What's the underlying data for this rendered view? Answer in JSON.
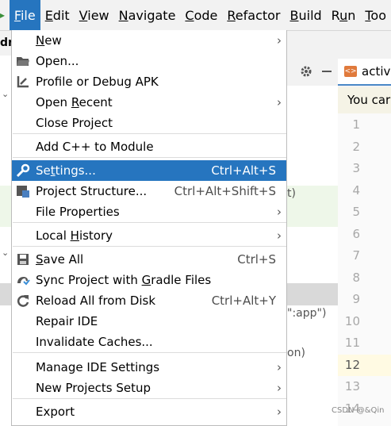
{
  "menubar": {
    "items": [
      {
        "label": "File",
        "mnemonic": "F"
      },
      {
        "label": "Edit",
        "mnemonic": "E"
      },
      {
        "label": "View",
        "mnemonic": "V"
      },
      {
        "label": "Navigate",
        "mnemonic": "N"
      },
      {
        "label": "Code",
        "mnemonic": "C"
      },
      {
        "label": "Refactor",
        "mnemonic": "R"
      },
      {
        "label": "Build",
        "mnemonic": "B"
      },
      {
        "label": "Run",
        "mnemonic": "u"
      },
      {
        "label": "Too",
        "mnemonic": "T"
      }
    ]
  },
  "background": {
    "project_partial": "dr",
    "right_paren_text": "t)",
    "app_text": "\":app\")",
    "on_text": "on)",
    "editor_tab_label": "activ",
    "banner_text": "You car",
    "line_numbers": [
      "1",
      "2",
      "3",
      "4",
      "5",
      "6",
      "7",
      "8",
      "9",
      "10",
      "11",
      "12",
      "13",
      "14"
    ],
    "current_line": "12",
    "watermark": "CSDN @&Qin"
  },
  "file_menu": {
    "items": [
      {
        "label": "New",
        "shortcut": "",
        "submenu": true
      },
      {
        "label": "Open...",
        "shortcut": "",
        "submenu": false
      },
      {
        "label": "Profile or Debug APK",
        "shortcut": "",
        "submenu": false
      },
      {
        "label": "Open Recent",
        "shortcut": "",
        "submenu": true
      },
      {
        "label": "Close Project",
        "shortcut": "",
        "submenu": false
      },
      {
        "label": "Add C++ to Module",
        "shortcut": "",
        "submenu": false
      },
      {
        "label": "Settings...",
        "shortcut": "Ctrl+Alt+S",
        "submenu": false,
        "selected": true
      },
      {
        "label": "Project Structure...",
        "shortcut": "Ctrl+Alt+Shift+S",
        "submenu": false
      },
      {
        "label": "File Properties",
        "shortcut": "",
        "submenu": true
      },
      {
        "label": "Local History",
        "shortcut": "",
        "submenu": true
      },
      {
        "label": "Save All",
        "shortcut": "Ctrl+S",
        "submenu": false
      },
      {
        "label": "Sync Project with Gradle Files",
        "shortcut": "",
        "submenu": false
      },
      {
        "label": "Reload All from Disk",
        "shortcut": "Ctrl+Alt+Y",
        "submenu": false
      },
      {
        "label": "Repair IDE",
        "shortcut": "",
        "submenu": false
      },
      {
        "label": "Invalidate Caches...",
        "shortcut": "",
        "submenu": false
      },
      {
        "label": "Manage IDE Settings",
        "shortcut": "",
        "submenu": true
      },
      {
        "label": "New Projects Setup",
        "shortcut": "",
        "submenu": true
      },
      {
        "label": "Export",
        "shortcut": "",
        "submenu": true
      }
    ]
  },
  "colors": {
    "selection": "#2675bf",
    "menu_bg": "#ffffff",
    "menubar_bg": "#f2f2f2"
  }
}
